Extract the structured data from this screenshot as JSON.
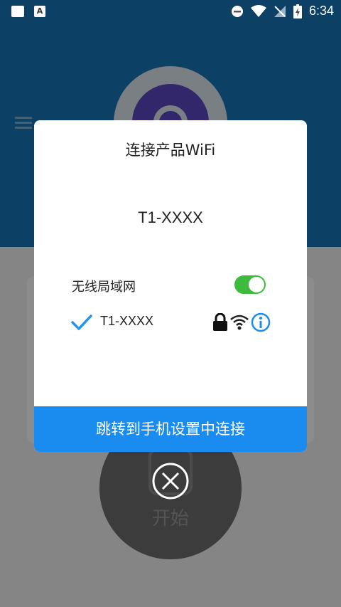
{
  "status_bar": {
    "time": "6:34",
    "icons": [
      "image-icon",
      "a-app-icon",
      "do-not-disturb-icon",
      "wifi-icon",
      "no-signal-icon",
      "battery-charging-icon"
    ],
    "a_glyph": "A"
  },
  "app": {
    "start_label": "开始"
  },
  "dialog": {
    "title": "连接产品WiFi",
    "ssid_large": "T1-XXXX",
    "wlan_label": "无线局域网",
    "wlan_enabled": true,
    "network": {
      "name": "T1-XXXX",
      "selected": true,
      "secured": true
    },
    "connect_button_label": "跳转到手机设置中连接"
  },
  "colors": {
    "header_blue": "#1676b8",
    "button_blue": "#1a8cf0",
    "toggle_green": "#3dbb3d",
    "check_blue": "#2196f3"
  }
}
